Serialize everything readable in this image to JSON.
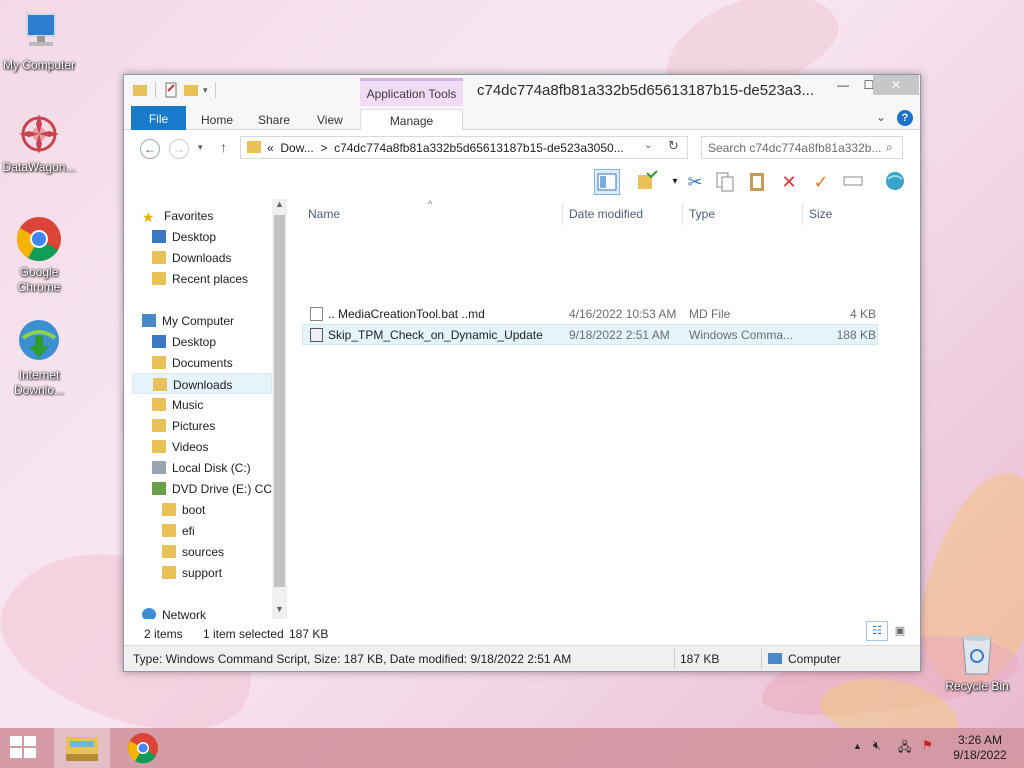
{
  "desktop": {
    "icons": [
      {
        "label": "My Computer"
      },
      {
        "label": "DataWagon..."
      },
      {
        "label": "Google Chrome"
      },
      {
        "label": "Internet Downlo..."
      }
    ],
    "recycle_bin": "Recycle Bin"
  },
  "window": {
    "context_tab": "Application Tools",
    "title": "c74dc774a8fb81a332b5d65613187b15-de523a3...",
    "controls": {
      "minimize": "—",
      "maximize": "☐",
      "close": "✕"
    },
    "tabs": {
      "file": "File",
      "home": "Home",
      "share": "Share",
      "view": "View",
      "manage": "Manage"
    },
    "help": "?"
  },
  "address": {
    "prefix": "«",
    "crumb1": "Dow...",
    "sep": ">",
    "crumb2": "c74dc774a8fb81a332b5d65613187b15-de523a3050...",
    "search_placeholder": "Search c74dc774a8fb81a332b..."
  },
  "nav": {
    "favorites": "Favorites",
    "fav_items": [
      "Desktop",
      "Downloads",
      "Recent places"
    ],
    "computer": "My Computer",
    "computer_items": [
      "Desktop",
      "Documents",
      "Downloads",
      "Music",
      "Pictures",
      "Videos",
      "Local Disk (C:)",
      "DVD Drive (E:) CC"
    ],
    "dvd_items": [
      "boot",
      "efi",
      "sources",
      "support"
    ],
    "network": "Network"
  },
  "list": {
    "headers": {
      "name": "Name",
      "date": "Date modified",
      "type": "Type",
      "size": "Size"
    },
    "rows": [
      {
        "name": ".. MediaCreationTool.bat ..md",
        "date": "4/16/2022 10:53 AM",
        "type": "MD File",
        "size": "4 KB"
      },
      {
        "name": "Skip_TPM_Check_on_Dynamic_Update",
        "date": "9/18/2022 2:51 AM",
        "type": "Windows Comma...",
        "size": "188 KB"
      }
    ]
  },
  "status": {
    "items": "2 items",
    "selected": "1 item selected",
    "size": "187 KB"
  },
  "details": {
    "text": "Type: Windows Command Script, Size: 187 KB, Date modified: 9/18/2022 2:51 AM",
    "size": "187 KB",
    "location": "Computer"
  },
  "taskbar": {
    "time": "3:26 AM",
    "date": "9/18/2022"
  },
  "colors": {
    "file_tab": "#1979ca",
    "context_tab": "#f1dcf5",
    "selection": "#e5f3fb"
  }
}
